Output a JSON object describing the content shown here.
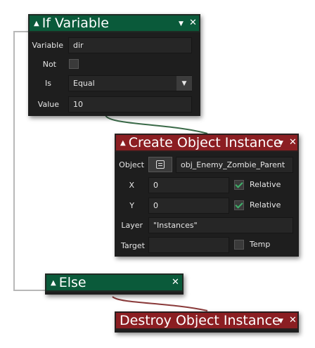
{
  "if_variable": {
    "title": "If Variable",
    "variable_label": "Variable",
    "variable_value": "dir",
    "not_label": "Not",
    "is_label": "Is",
    "is_value": "Equal",
    "value_label": "Value",
    "value_value": "10"
  },
  "create_instance": {
    "title": "Create Object Instance",
    "object_label": "Object",
    "object_value": "obj_Enemy_Zombie_Parent",
    "x_label": "X",
    "x_value": "0",
    "x_relative_label": "Relative",
    "y_label": "Y",
    "y_value": "0",
    "y_relative_label": "Relative",
    "layer_label": "Layer",
    "layer_value": "\"Instances\"",
    "target_label": "Target",
    "target_value": "",
    "temp_label": "Temp"
  },
  "else_block": {
    "title": "Else"
  },
  "destroy_instance": {
    "title": "Destroy Object Instance"
  },
  "colors": {
    "header_green": "#0a5a3a",
    "header_red": "#8b1e22",
    "panel_bg": "#1e1e1e",
    "field_bg": "#262626",
    "check_green": "#3fb06a"
  },
  "icons": {
    "collapse": "triangle-up-icon",
    "menu": "chevron-down-icon",
    "close": "close-icon",
    "object_picker": "object-picker-icon"
  }
}
